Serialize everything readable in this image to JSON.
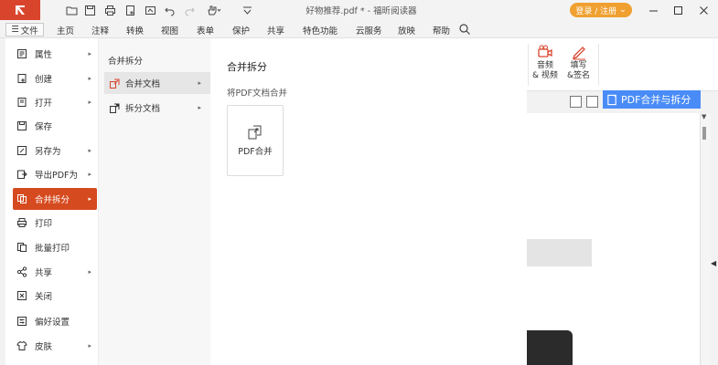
{
  "titlebar": {
    "window_title": "好物推荐.pdf * - 福昕阅读器",
    "login_label": "登录 / 注册",
    "logo_icon": "foxit-logo-icon",
    "brand_color": "#d9442d",
    "login_color": "#f0a030"
  },
  "menubar": {
    "file_label": "文件",
    "tabs": [
      "主页",
      "注释",
      "转换",
      "视图",
      "表单",
      "保护",
      "共享",
      "特色功能",
      "云服务",
      "放映",
      "帮助"
    ]
  },
  "ribbon": {
    "buttons": [
      {
        "label1": "音频",
        "label2": "& 视频",
        "icon": "av-icon"
      },
      {
        "label1": "填写",
        "label2": "&签名",
        "icon": "sign-icon"
      }
    ]
  },
  "file_menu": {
    "items": [
      {
        "label": "属性",
        "icon": "properties-icon",
        "submenu": true
      },
      {
        "label": "创建",
        "icon": "create-icon",
        "submenu": true
      },
      {
        "label": "打开",
        "icon": "open-icon",
        "submenu": true
      },
      {
        "label": "保存",
        "icon": "save-icon",
        "submenu": false
      },
      {
        "label": "另存为",
        "icon": "save-as-icon",
        "submenu": true
      },
      {
        "label": "导出PDF为",
        "icon": "export-icon",
        "submenu": true
      },
      {
        "label": "合并拆分",
        "icon": "merge-split-icon",
        "submenu": true,
        "active": true
      },
      {
        "label": "打印",
        "icon": "print-icon",
        "submenu": false
      },
      {
        "label": "批量打印",
        "icon": "batch-print-icon",
        "submenu": false
      },
      {
        "label": "共享",
        "icon": "share-icon",
        "submenu": true
      },
      {
        "label": "关闭",
        "icon": "close-doc-icon",
        "submenu": false
      },
      {
        "label": "偏好设置",
        "icon": "preferences-icon",
        "submenu": false
      },
      {
        "label": "皮肤",
        "icon": "skin-icon",
        "submenu": true
      }
    ],
    "active_color": "#d64a1f"
  },
  "submenu": {
    "heading": "合并拆分",
    "items": [
      {
        "label": "合并文档",
        "icon": "merge-doc-icon",
        "active": true
      },
      {
        "label": "拆分文档",
        "icon": "split-doc-icon",
        "active": false
      }
    ]
  },
  "panel": {
    "title": "合并拆分",
    "subtitle": "将PDF文档合并",
    "card_label": "PDF合并",
    "card_icon": "pdf-merge-icon"
  },
  "document": {
    "banner_text": "PDF合并与拆分",
    "banner_color": "#4a8cf7"
  }
}
